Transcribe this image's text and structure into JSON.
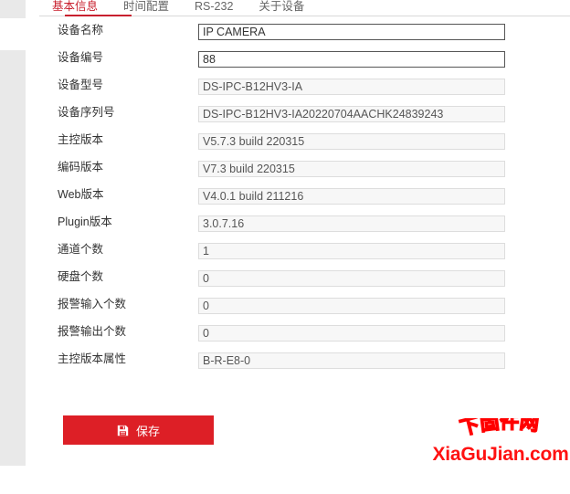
{
  "tabs": [
    {
      "label": "基本信息",
      "active": true
    },
    {
      "label": "时间配置",
      "active": false
    },
    {
      "label": "RS-232",
      "active": false
    },
    {
      "label": "关于设备",
      "active": false
    }
  ],
  "form": {
    "rows": [
      {
        "label": "设备名称",
        "value": "IP CAMERA",
        "readonly": false,
        "name": "device-name"
      },
      {
        "label": "设备编号",
        "value": "88",
        "readonly": false,
        "name": "device-number"
      },
      {
        "label": "设备型号",
        "value": "DS-IPC-B12HV3-IA",
        "readonly": true,
        "name": "device-model"
      },
      {
        "label": "设备序列号",
        "value": "DS-IPC-B12HV3-IA20220704AACHK24839243",
        "readonly": true,
        "name": "device-serial-number"
      },
      {
        "label": "主控版本",
        "value": "V5.7.3 build 220315",
        "readonly": true,
        "name": "firmware-version"
      },
      {
        "label": "编码版本",
        "value": "V7.3 build 220315",
        "readonly": true,
        "name": "encoding-version"
      },
      {
        "label": "Web版本",
        "value": "V4.0.1 build 211216",
        "readonly": true,
        "name": "web-version"
      },
      {
        "label": "Plugin版本",
        "value": "3.0.7.16",
        "readonly": true,
        "name": "plugin-version"
      },
      {
        "label": "通道个数",
        "value": "1",
        "readonly": true,
        "name": "channel-count"
      },
      {
        "label": "硬盘个数",
        "value": "0",
        "readonly": true,
        "name": "hdd-count"
      },
      {
        "label": "报警输入个数",
        "value": "0",
        "readonly": true,
        "name": "alarm-input-count"
      },
      {
        "label": "报警输出个数",
        "value": "0",
        "readonly": true,
        "name": "alarm-output-count"
      },
      {
        "label": "主控版本属性",
        "value": "B-R-E8-0",
        "readonly": true,
        "name": "firmware-version-property"
      }
    ]
  },
  "save_button": {
    "label": "保存",
    "icon": "floppy-disk-icon",
    "color": "#dd1f26"
  },
  "watermark": {
    "arc_text": "下固件网",
    "domain_text": "XiaGuJian.com",
    "color": "#ff0000"
  }
}
